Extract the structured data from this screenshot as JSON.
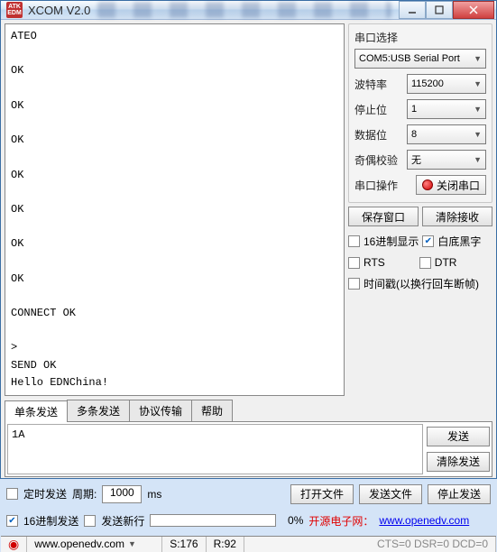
{
  "window": {
    "title": "XCOM V2.0",
    "appicon_text": "ATK\nEDM"
  },
  "output_text": "ATEO\n\nOK\n\nOK\n\nOK\n\nOK\n\nOK\n\nOK\n\nOK\n\nCONNECT OK\n\n>\nSEND OK\nHello EDNChina!",
  "side": {
    "port_select_label": "串口选择",
    "port_value": "COM5:USB Serial Port",
    "baud_label": "波特率",
    "baud_value": "115200",
    "stop_label": "停止位",
    "stop_value": "1",
    "data_label": "数据位",
    "data_value": "8",
    "parity_label": "奇偶校验",
    "parity_value": "无",
    "op_label": "串口操作",
    "op_button": "关闭串口",
    "save_window": "保存窗口",
    "clear_recv": "清除接收",
    "hex_display": "16进制显示",
    "white_bg": "白底黑字",
    "rts": "RTS",
    "dtr": "DTR",
    "timestamp": "时间戳(以换行回车断帧)"
  },
  "tabs": {
    "single": "单条发送",
    "multi": "多条发送",
    "proto": "协议传输",
    "help": "帮助"
  },
  "send": {
    "input_value": "1A",
    "send_btn": "发送",
    "clear_btn": "清除发送"
  },
  "opts": {
    "timed_send": "定时发送",
    "period_label": "周期:",
    "period_value": "1000",
    "period_unit": "ms",
    "open_file": "打开文件",
    "send_file": "发送文件",
    "stop_send": "停止发送",
    "hex_send": "16进制发送",
    "send_newline": "发送新行",
    "pct": "0%",
    "link_label": "开源电子网：",
    "link_url": "www.openedv.com"
  },
  "status": {
    "url": "www.openedv.com",
    "s": "S:176",
    "r": "R:92",
    "tail": "CTS=0 DSR=0 DCD=0"
  }
}
